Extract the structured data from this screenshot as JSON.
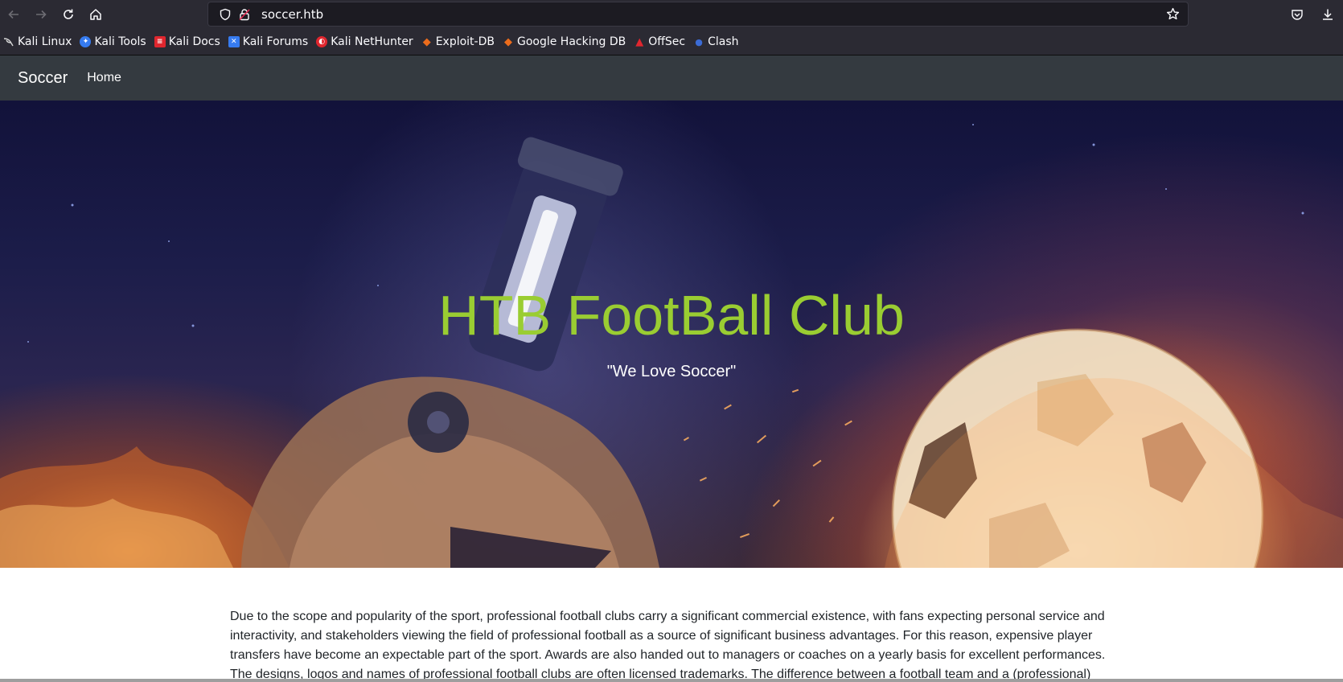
{
  "browser": {
    "url": "soccer.htb",
    "nav": {
      "back_icon": "arrow-left-icon",
      "forward_icon": "arrow-right-icon",
      "reload_icon": "reload-icon",
      "home_icon": "home-icon"
    }
  },
  "bookmarks": [
    {
      "label": "Kali Linux",
      "icon": "kali-dragon-icon",
      "color": "#9b9b9b"
    },
    {
      "label": "Kali Tools",
      "icon": "kali-tools-icon",
      "color": "#367bf0"
    },
    {
      "label": "Kali Docs",
      "icon": "kali-docs-icon",
      "color": "#e0262e"
    },
    {
      "label": "Kali Forums",
      "icon": "kali-forums-icon",
      "color": "#367bf0"
    },
    {
      "label": "Kali NetHunter",
      "icon": "nethunter-icon",
      "color": "#e0262e"
    },
    {
      "label": "Exploit-DB",
      "icon": "exploit-db-icon",
      "color": "#ec6c1c"
    },
    {
      "label": "Google Hacking DB",
      "icon": "ghdb-icon",
      "color": "#ec6c1c"
    },
    {
      "label": "OffSec",
      "icon": "offsec-icon",
      "color": "#e0262e"
    },
    {
      "label": "Clash",
      "icon": "clash-icon",
      "color": "#3b6bd6"
    }
  ],
  "site": {
    "brand": "Soccer",
    "nav_home": "Home",
    "hero_title": "HTB FootBall Club",
    "hero_subtitle": "\"We Love Soccer\"",
    "body_text": "Due to the scope and popularity of the sport, professional football clubs carry a significant commercial existence, with fans expecting personal service and interactivity, and stakeholders viewing the field of professional football as a source of significant business advantages. For this reason, expensive player transfers have become an expectable part of the sport. Awards are also handed out to managers or coaches on a yearly basis for excellent performances. The designs, logos and names of professional football clubs are often licensed trademarks. The difference between a football team and a (professional)"
  },
  "colors": {
    "hero_title": "#9acd32",
    "navbar_bg": "#343a40",
    "browser_chrome": "#2b2a33"
  }
}
